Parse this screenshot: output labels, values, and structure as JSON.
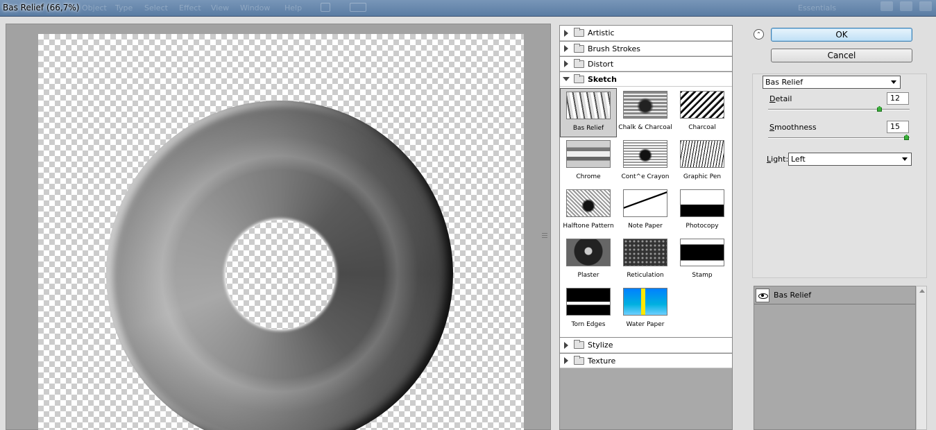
{
  "window": {
    "title": "Bas Relief (66,7%)",
    "ghost_menu": [
      "Object",
      "Type",
      "Select",
      "Effect",
      "View",
      "Window",
      "Help"
    ],
    "ghost_right": "Essentials"
  },
  "gallery": {
    "categories_top": [
      {
        "label": "Artistic",
        "expanded": false
      },
      {
        "label": "Brush Strokes",
        "expanded": false
      },
      {
        "label": "Distort",
        "expanded": false
      },
      {
        "label": "Sketch",
        "expanded": true
      }
    ],
    "sketch_filters": [
      {
        "label": "Bas Relief",
        "selected": true
      },
      {
        "label": "Chalk & Charcoal"
      },
      {
        "label": "Charcoal"
      },
      {
        "label": "Chrome"
      },
      {
        "label": "Cont^e Crayon"
      },
      {
        "label": "Graphic Pen"
      },
      {
        "label": "Halftone Pattern"
      },
      {
        "label": "Note Paper"
      },
      {
        "label": "Photocopy"
      },
      {
        "label": "Plaster"
      },
      {
        "label": "Reticulation"
      },
      {
        "label": "Stamp"
      },
      {
        "label": "Torn Edges"
      },
      {
        "label": "Water Paper"
      }
    ],
    "categories_bottom": [
      {
        "label": "Stylize",
        "expanded": false
      },
      {
        "label": "Texture",
        "expanded": false
      }
    ]
  },
  "buttons": {
    "ok": "OK",
    "cancel": "Cancel"
  },
  "settings": {
    "filter_select": "Bas Relief",
    "detail": {
      "label_u": "D",
      "label_rest": "etail",
      "value": "12",
      "max": 15
    },
    "smoothness": {
      "label_u": "S",
      "label_rest": "moothness",
      "value": "15",
      "max": 15
    },
    "light": {
      "label_u": "L",
      "label_rest": "ight:",
      "value": "Left"
    }
  },
  "effect_layers": [
    {
      "name": "Bas Relief",
      "visible": true
    }
  ],
  "colors": {
    "accent": "#3c7fb1",
    "slider_thumb": "#3ab03a",
    "panel_bg": "#a9a9a9"
  }
}
